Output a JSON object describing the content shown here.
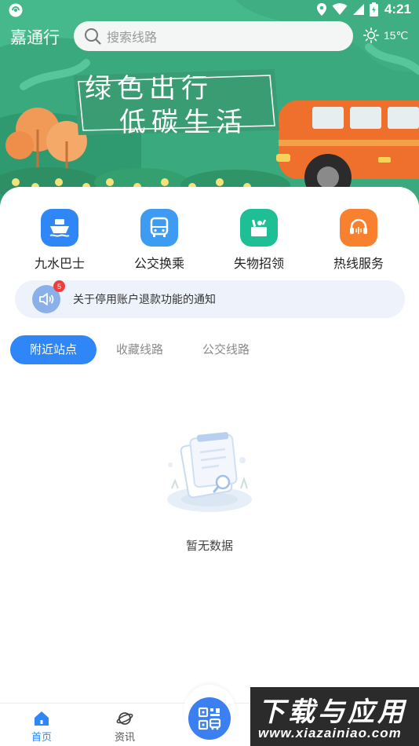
{
  "status_bar": {
    "time": "4:21"
  },
  "header": {
    "app_title": "嘉通行",
    "search_placeholder": "搜索线路",
    "weather_temp": "15℃"
  },
  "banner": {
    "slogan_line1": "绿色出行",
    "slogan_line2": "低碳生活"
  },
  "quick_actions": [
    {
      "label": "九水巴士",
      "icon": "ship-icon",
      "color": "#2f86f6"
    },
    {
      "label": "公交换乘",
      "icon": "bus-icon",
      "color": "#3d9cf2"
    },
    {
      "label": "失物招领",
      "icon": "lost-found-icon",
      "color": "#1fbf95"
    },
    {
      "label": "热线服务",
      "icon": "headset-icon",
      "color": "#f7812f"
    }
  ],
  "notice": {
    "badge": "5",
    "text": "关于停用账户退款功能的通知"
  },
  "tabs": [
    "附近站点",
    "收藏线路",
    "公交线路"
  ],
  "empty_state": {
    "text": "暂无数据"
  },
  "bottom_nav": {
    "home_label": "首页",
    "news_label": "资讯"
  },
  "watermark": {
    "main": "下载与应用",
    "sub": "www.xiazainiao.com"
  }
}
